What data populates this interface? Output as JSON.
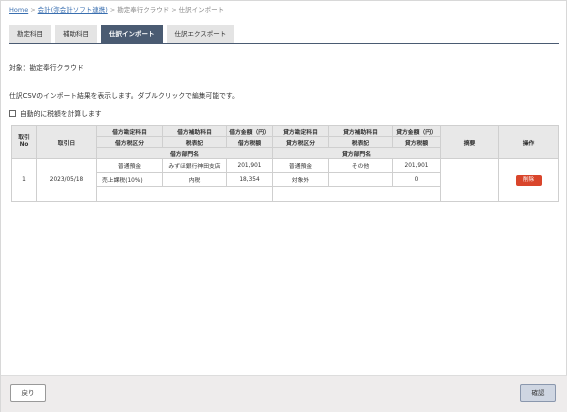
{
  "breadcrumb": {
    "home": "Home",
    "accounting": "会計(弥会計ソフト連携)",
    "cloud": "勘定奉行クラウド",
    "current": "仕訳インポート",
    "separator": ">"
  },
  "tabs": [
    {
      "label": "勘定科目",
      "active": false
    },
    {
      "label": "補助科目",
      "active": false
    },
    {
      "label": "仕訳インポート",
      "active": true
    },
    {
      "label": "仕訳エクスポート",
      "active": false
    }
  ],
  "target_label": "対象：勘定奉行クラウド",
  "description": "仕訳CSVのインポート結果を表示します。ダブルクリックで編集可能です。",
  "auto_tax_label": "自動的に税額を計算します",
  "table": {
    "headers": {
      "row_no": "取引\nNo",
      "date": "取引日",
      "debit_account": "借方勘定科目",
      "debit_sub": "借方補助科目",
      "debit_amount": "借方金額（円）",
      "credit_account": "貸方勘定科目",
      "credit_sub": "貸方補助科目",
      "credit_amount": "貸方金額（円）",
      "summary": "摘要",
      "action": "操作",
      "debit_tax_class": "借方税区分",
      "debit_tax_note": "税表記",
      "debit_tax_amount": "借方税額",
      "credit_tax_class": "貸方税区分",
      "credit_tax_note": "税表記",
      "credit_tax_amount": "貸方税額",
      "debit_dept": "借方部門名",
      "credit_dept": "貸方部門名"
    },
    "row": {
      "no": "1",
      "date": "2023/05/18",
      "debit_account": "普通預金",
      "debit_sub": "みずほ銀行神田支店",
      "debit_amount": "201,901",
      "credit_account": "普通預金",
      "credit_sub": "その他",
      "credit_amount": "201,901",
      "debit_tax_class": "売上課税(10%)",
      "debit_tax_note": "内税",
      "debit_tax_amount": "18,354",
      "credit_tax_class": "対象外",
      "credit_tax_note": "",
      "credit_tax_amount": "0",
      "summary": "",
      "delete_label": "削除"
    }
  },
  "footer": {
    "back_label": "戻り",
    "confirm_label": "確認"
  }
}
